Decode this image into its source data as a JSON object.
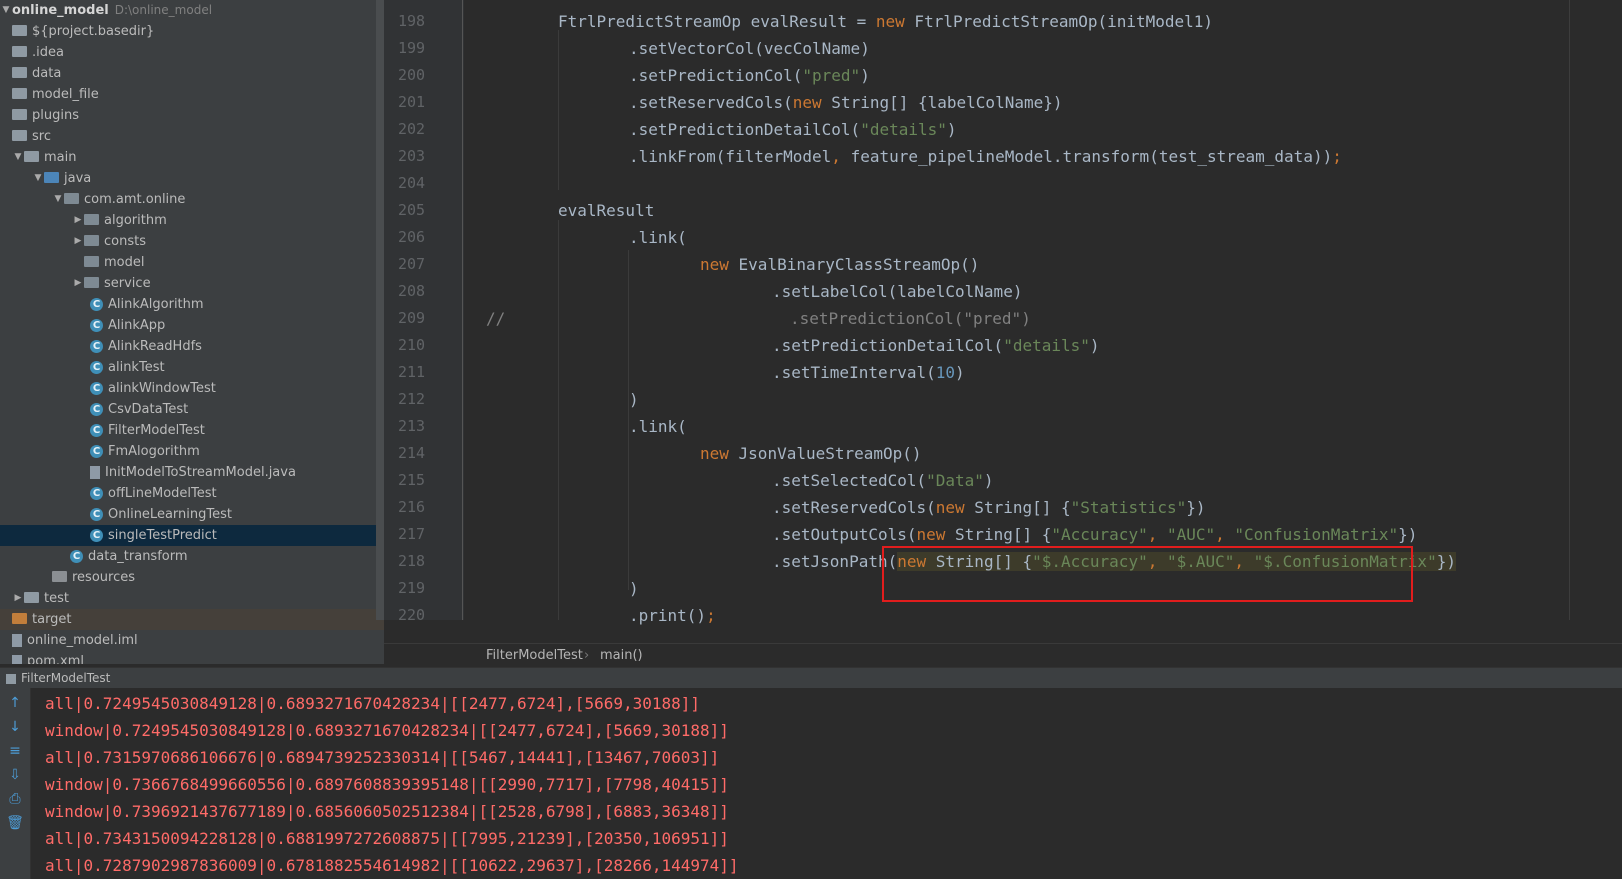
{
  "project": {
    "root_name": "online_model",
    "root_path": "D:\\online_model",
    "items": [
      {
        "label": "${project.basedir}",
        "icon": "folder"
      },
      {
        "label": ".idea",
        "icon": "folder"
      },
      {
        "label": "data",
        "icon": "folder"
      },
      {
        "label": "model_file",
        "icon": "folder"
      },
      {
        "label": "plugins",
        "icon": "folder"
      },
      {
        "label": "src",
        "icon": "folder"
      },
      {
        "label": "main",
        "icon": "folder"
      },
      {
        "label": "java",
        "icon": "source-folder"
      },
      {
        "label": "com.amt.online",
        "icon": "package"
      },
      {
        "label": "algorithm",
        "icon": "package"
      },
      {
        "label": "consts",
        "icon": "package"
      },
      {
        "label": "model",
        "icon": "package"
      },
      {
        "label": "service",
        "icon": "package"
      },
      {
        "label": "AlinkAlgorithm",
        "icon": "class"
      },
      {
        "label": "AlinkApp",
        "icon": "class"
      },
      {
        "label": "AlinkReadHdfs",
        "icon": "class"
      },
      {
        "label": "alinkTest",
        "icon": "class"
      },
      {
        "label": "alinkWindowTest",
        "icon": "class"
      },
      {
        "label": "CsvDataTest",
        "icon": "class"
      },
      {
        "label": "FilterModelTest",
        "icon": "class"
      },
      {
        "label": "FmAlogorithm",
        "icon": "class"
      },
      {
        "label": "InitModelToStreamModel.java",
        "icon": "java-file"
      },
      {
        "label": "offLineModelTest",
        "icon": "class"
      },
      {
        "label": "OnlineLearningTest",
        "icon": "class"
      },
      {
        "label": "singleTestPredict",
        "icon": "class"
      },
      {
        "label": "data_transform",
        "icon": "class"
      },
      {
        "label": "resources",
        "icon": "resources-folder"
      },
      {
        "label": "test",
        "icon": "folder"
      },
      {
        "label": "target",
        "icon": "excluded-folder"
      },
      {
        "label": "online_model.iml",
        "icon": "iml-file"
      },
      {
        "label": "pom.xml",
        "icon": "xml-file"
      }
    ]
  },
  "editor": {
    "line_numbers": [
      "198",
      "199",
      "200",
      "201",
      "202",
      "203",
      "204",
      "205",
      "206",
      "207",
      "208",
      "209",
      "210",
      "211",
      "212",
      "213",
      "214",
      "215",
      "216",
      "217",
      "218",
      "219",
      "220"
    ],
    "code": {
      "l198a": "FtrlPredictStreamOp evalResult = ",
      "l198kw": "new",
      "l198b": " FtrlPredictStreamOp(initModel1)",
      "l199": ".setVectorCol(vecColName)",
      "l200a": ".setPredictionCol(",
      "l200s": "\"pred\"",
      "l200b": ")",
      "l201a": ".setReservedCols(",
      "l201kw": "new",
      "l201b": " String[] {labelColName})",
      "l202a": ".setPredictionDetailCol(",
      "l202s": "\"details\"",
      "l202b": ")",
      "l203a": ".linkFrom(filterModel",
      "l203c": ",",
      "l203b": " feature_pipelineModel.transform(test_stream_data))",
      "l203e": ";",
      "l205": "evalResult",
      "l206": ".link(",
      "l207kw": "new",
      "l207b": " EvalBinaryClassStreamOp()",
      "l208": ".setLabelCol(labelColName)",
      "l209c": "//",
      "l209b": ".setPredictionCol(\"pred\")",
      "l210a": ".setPredictionDetailCol(",
      "l210s": "\"details\"",
      "l210b": ")",
      "l211a": ".setTimeInterval(",
      "l211n": "10",
      "l211b": ")",
      "l212": ")",
      "l213": ".link(",
      "l214kw": "new",
      "l214b": " JsonValueStreamOp()",
      "l215a": ".setSelectedCol(",
      "l215s": "\"Data\"",
      "l215b": ")",
      "l216a": ".setReservedCols(",
      "l216kw": "new",
      "l216b": " String[] {",
      "l216s": "\"Statistics\"",
      "l216e": "})",
      "l217a": ".setOutputCols(",
      "l217kw": "new",
      "l217b": " String[] {",
      "l217s1": "\"Accuracy\"",
      "l217c1": ", ",
      "l217s2": "\"AUC\"",
      "l217c2": ", ",
      "l217s3": "\"ConfusionMatrix\"",
      "l217e": "})",
      "l218a": ".setJsonPath(",
      "l218kw": "new",
      "l218b": " String[] {",
      "l218s1": "\"$.Accuracy\"",
      "l218c1": ", ",
      "l218s2": "\"$.AUC\"",
      "l218c2": ", ",
      "l218s3": "\"$.ConfusionMatrix\"",
      "l218e": "})",
      "l219": ")",
      "l220a": ".print()",
      "l220e": ";"
    }
  },
  "breadcrumb": {
    "class_name": "FilterModelTest",
    "separator": "›",
    "method": "main()"
  },
  "run": {
    "tab_label": "FilterModelTest",
    "output": [
      "all|0.7249545030849128|0.6893271670428234|[[2477,6724],[5669,30188]]",
      "window|0.7249545030849128|0.6893271670428234|[[2477,6724],[5669,30188]]",
      "all|0.7315970686106676|0.6894739252330314|[[5467,14441],[13467,70603]]",
      "window|0.7366768499660556|0.6897608839395148|[[2990,7717],[7798,40415]]",
      "window|0.7396921437677189|0.6856060502512384|[[2528,6798],[6883,36348]]",
      "all|0.7343150094228128|0.6881997272608875|[[7995,21239],[20350,106951]]",
      "all|0.7287902987836009|0.6781882554614982|[[10622,29637],[28266,144974]]"
    ]
  }
}
